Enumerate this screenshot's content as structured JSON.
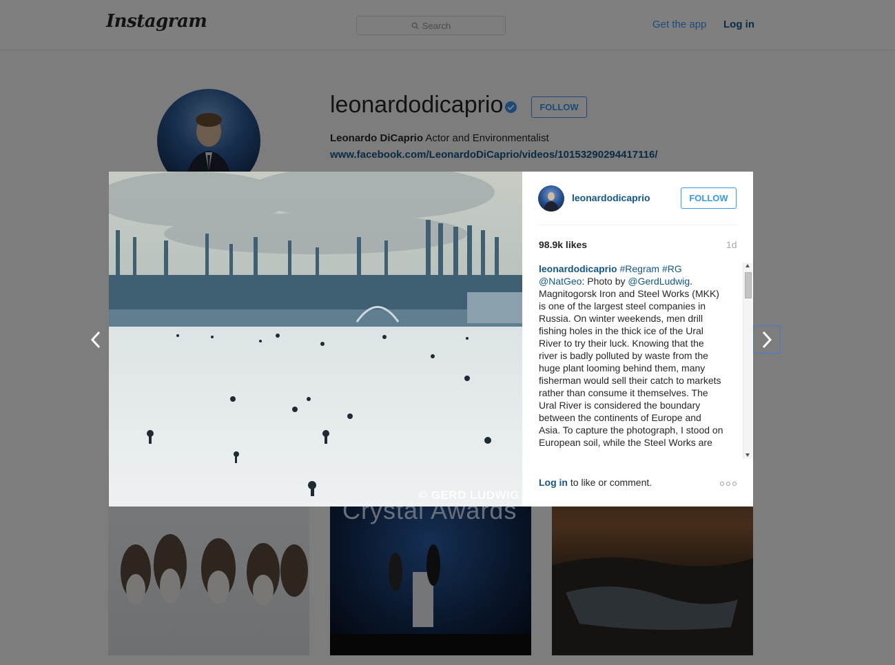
{
  "header": {
    "logo": "Instagram",
    "search_placeholder": "Search",
    "get_app": "Get the app",
    "login": "Log in"
  },
  "profile": {
    "username": "leonardodicaprio",
    "follow": "FOLLOW",
    "full_name": "Leonardo DiCaprio",
    "bio": " Actor and Environmentalist",
    "link": "www.facebook.com/LeonardoDiCaprio/videos/10153290294417116/"
  },
  "grid": {
    "tile2_text": "Crystal Awards"
  },
  "modal": {
    "username": "leonardodicaprio",
    "follow": "FOLLOW",
    "likes": "98.9k likes",
    "time": "1d",
    "watermark": "© GERD LUDWIG",
    "caption_user": "leonardodicaprio",
    "caption_tag1": "#Regram",
    "caption_tag2": "#RG",
    "caption_mention1": "@NatGeo",
    "caption_mid": ": Photo by ",
    "caption_mention2": "@GerdLudwig",
    "caption_body": ". Magnitogorsk Iron and Steel Works (MKK) is one of the largest steel companies in Russia. On winter weekends, men drill fishing holes in the thick ice of the Ural River to try their luck. Knowing that the river is badly polluted by waste from the huge plant looming behind them, many fisherman would sell their catch to markets rather than consume it themselves. The Ural River is considered the boundary between the continents of Europe and Asia. To capture the photograph, I stood on European soil, while the Steel Works are",
    "login_link": "Log in",
    "login_text": " to like or comment."
  },
  "icons": {
    "search": "search-icon",
    "verified": "verified-badge-icon",
    "prev": "chevron-left-icon",
    "next": "chevron-right-icon",
    "more": "more-options-icon"
  },
  "colors": {
    "link_blue": "#125688",
    "accent_blue": "#3897f0",
    "overlay": "rgba(0,0,0,0.5)"
  }
}
